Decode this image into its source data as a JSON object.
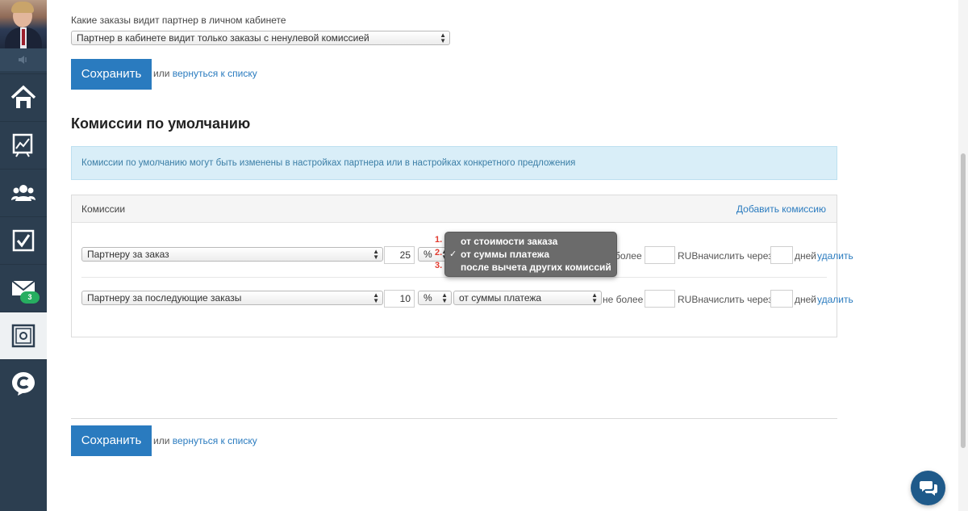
{
  "sidebar": {
    "items": [
      {
        "icon": "home-icon"
      },
      {
        "icon": "chart-icon"
      },
      {
        "icon": "users-icon"
      },
      {
        "icon": "checkbox-icon"
      },
      {
        "icon": "mail-icon",
        "badge": "3"
      },
      {
        "icon": "safe-icon"
      },
      {
        "icon": "logo-c-icon"
      }
    ]
  },
  "visibility": {
    "label": "Какие заказы видит партнер в личном кабинете",
    "selected": "Партнер в кабинете видит только заказы с ненулевой комиссией"
  },
  "actions": {
    "save_label": "Сохранить",
    "or_text": "или",
    "back_link": "вернуться к списку"
  },
  "section": {
    "title": "Комиссии по умолчанию",
    "info": "Комиссии по умолчанию могут быть изменены в настройках партнера или в настройках конкретного предложения"
  },
  "commissions": {
    "header": "Комиссии",
    "add_link": "Добавить комиссию",
    "rows": [
      {
        "type": "Партнеру за заказ",
        "value": "25",
        "unit": "%",
        "base": "от суммы платежа",
        "max_label": "не более",
        "max_value": "",
        "currency_label": "RUBначислить через",
        "days_value": "",
        "days_label": "дней",
        "delete_link": "удалить"
      },
      {
        "type": "Партнеру за последующие заказы",
        "value": "10",
        "unit": "%",
        "base": "от суммы платежа",
        "max_label": "не более",
        "max_value": "",
        "currency_label": "RUBначислить через",
        "days_value": "",
        "days_label": "дней",
        "delete_link": "удалить"
      }
    ]
  },
  "dropdown": {
    "options": [
      {
        "num": "1.",
        "label": "от стоимости заказа",
        "checked": false
      },
      {
        "num": "2.",
        "label": "от суммы платежа",
        "checked": true
      },
      {
        "num": "3.",
        "label": "после вычета других комиссий",
        "checked": false
      }
    ],
    "check_mark": "✓"
  },
  "colors": {
    "sidebar": "#2c3e50",
    "accent": "#2a7bbf",
    "info_bg": "#d9eef8",
    "badge": "#27ae60"
  }
}
